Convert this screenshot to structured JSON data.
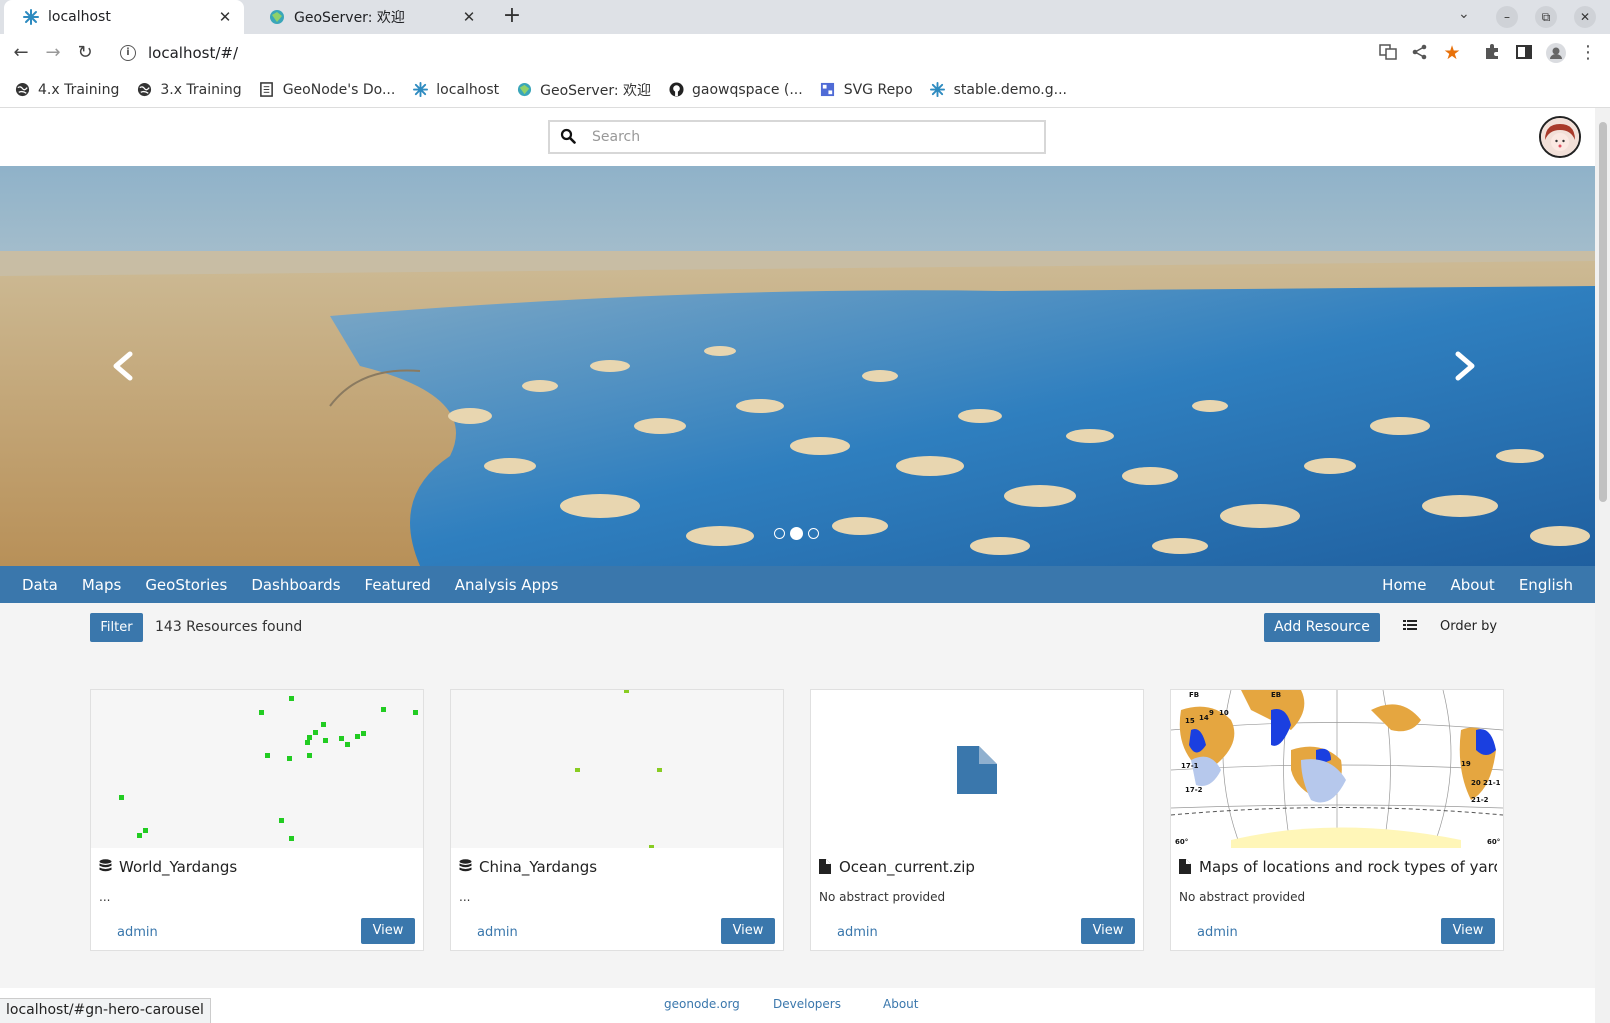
{
  "browser": {
    "tabs": [
      {
        "title": "localhost",
        "icon": "geonode-icon",
        "active": true
      },
      {
        "title": "GeoServer: 欢迎",
        "icon": "geoserver-icon",
        "active": false
      }
    ],
    "new_tab_label": "+",
    "tab_dropdown": "⌄",
    "window_controls": {
      "minimize": "–",
      "restore": "⧉",
      "close": "✕"
    },
    "address": "localhost/#/",
    "bookmarks": [
      {
        "label": "4.x Training",
        "icon": "globe-icon"
      },
      {
        "label": "3.x Training",
        "icon": "globe-icon"
      },
      {
        "label": "GeoNode's Do...",
        "icon": "document-icon"
      },
      {
        "label": "localhost",
        "icon": "geonode-icon"
      },
      {
        "label": "GeoServer: 欢迎",
        "icon": "geoserver-icon"
      },
      {
        "label": "gaowqspace (...",
        "icon": "github-icon"
      },
      {
        "label": "SVG Repo",
        "icon": "svgrepo-icon"
      },
      {
        "label": "stable.demo.g...",
        "icon": "geonode-icon"
      }
    ],
    "status_url": "localhost/#gn-hero-carousel"
  },
  "header": {
    "search_placeholder": "Search"
  },
  "carousel": {
    "slide_count": 3,
    "active_slide": 2
  },
  "nav": {
    "left": [
      "Data",
      "Maps",
      "GeoStories",
      "Dashboards",
      "Featured",
      "Analysis Apps"
    ],
    "right": [
      "Home",
      "About",
      "English"
    ]
  },
  "toolbar": {
    "filter_label": "Filter",
    "resource_count": "143 Resources found",
    "add_resource_label": "Add Resource",
    "order_by_label": "Order by"
  },
  "cards": [
    {
      "title": "World_Yardangs",
      "type_icon": "dataset-icon",
      "abstract": "...",
      "owner": "admin",
      "view_label": "View"
    },
    {
      "title": "China_Yardangs",
      "type_icon": "dataset-icon",
      "abstract": "...",
      "owner": "admin",
      "view_label": "View"
    },
    {
      "title": "Ocean_current.zip",
      "type_icon": "file-icon",
      "abstract": "No abstract provided",
      "owner": "admin",
      "view_label": "View"
    },
    {
      "title": "Maps of locations and rock types of yarda...",
      "type_icon": "file-icon",
      "abstract": "No abstract provided",
      "owner": "admin",
      "view_label": "View"
    }
  ],
  "map_labels": [
    "FB",
    "EB",
    "15",
    "14",
    "9",
    "10",
    "17-1",
    "17-2",
    "19",
    "20",
    "21-1",
    "21-2",
    "60°",
    "60°"
  ],
  "footer": {
    "links": [
      "geonode.org",
      "Developers",
      "About"
    ]
  },
  "colors": {
    "primary": "#3a77ac",
    "point_green": "#22cc22",
    "point_lime": "#88cc22"
  }
}
